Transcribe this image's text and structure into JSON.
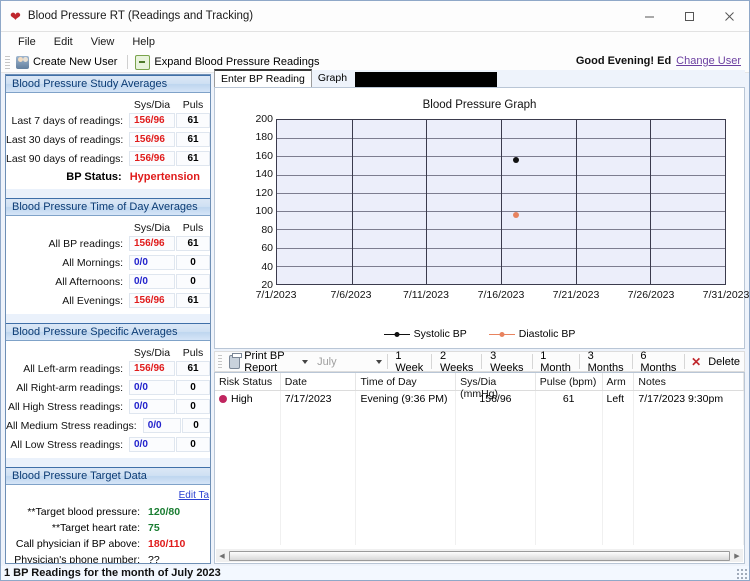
{
  "window": {
    "title": "Blood Pressure RT (Readings and Tracking)",
    "icon": "heart-icon",
    "minimize": "–",
    "maximize": "□",
    "close": "✕"
  },
  "menu": [
    "File",
    "Edit",
    "View",
    "Help"
  ],
  "toolbar": {
    "create_user": "Create New User",
    "expand_readings": "Expand Blood Pressure Readings",
    "greeting": "Good Evening! Ed",
    "change_user": "Change User"
  },
  "sidebar": {
    "study": {
      "title": "Blood Pressure Study Averages",
      "col_sysdia": "Sys/Dia",
      "col_pulse": "Puls",
      "rows": [
        {
          "label": "Last 7 days of readings:",
          "sysdia": "156/96",
          "pulse": "61",
          "tone": "red"
        },
        {
          "label": "Last 30 days of readings:",
          "sysdia": "156/96",
          "pulse": "61",
          "tone": "red"
        },
        {
          "label": "Last 90 days of readings:",
          "sysdia": "156/96",
          "pulse": "61",
          "tone": "red"
        }
      ],
      "status_label": "BP Status:",
      "status_value": "Hypertension"
    },
    "timeofday": {
      "title": "Blood Pressure Time of Day Averages",
      "col_sysdia": "Sys/Dia",
      "col_pulse": "Puls",
      "rows": [
        {
          "label": "All BP readings:",
          "sysdia": "156/96",
          "pulse": "61",
          "tone": "red"
        },
        {
          "label": "All Mornings:",
          "sysdia": "0/0",
          "pulse": "0",
          "tone": "blue"
        },
        {
          "label": "All Afternoons:",
          "sysdia": "0/0",
          "pulse": "0",
          "tone": "blue"
        },
        {
          "label": "All Evenings:",
          "sysdia": "156/96",
          "pulse": "61",
          "tone": "red"
        }
      ]
    },
    "specific": {
      "title": "Blood Pressure Specific Averages",
      "col_sysdia": "Sys/Dia",
      "col_pulse": "Puls",
      "rows": [
        {
          "label": "All Left-arm readings:",
          "sysdia": "156/96",
          "pulse": "61",
          "tone": "red"
        },
        {
          "label": "All Right-arm readings:",
          "sysdia": "0/0",
          "pulse": "0",
          "tone": "blue"
        },
        {
          "label": "All High Stress readings:",
          "sysdia": "0/0",
          "pulse": "0",
          "tone": "blue"
        },
        {
          "label": "All Medium Stress readings:",
          "sysdia": "0/0",
          "pulse": "0",
          "tone": "blue"
        },
        {
          "label": "All Low Stress readings:",
          "sysdia": "0/0",
          "pulse": "0",
          "tone": "blue"
        }
      ]
    },
    "target": {
      "title": "Blood Pressure Target Data",
      "edit_link": "Edit Ta",
      "rows": [
        {
          "label": "**Target blood pressure:",
          "value": "120/80",
          "tone": "green"
        },
        {
          "label": "**Target heart rate:",
          "value": "75",
          "tone": "green"
        },
        {
          "label": "Call physician if BP above:",
          "value": "180/110",
          "tone": "red"
        },
        {
          "label": "Physician's phone number:",
          "value": "??",
          "tone": "black"
        }
      ]
    }
  },
  "tabs": [
    {
      "label": "Enter BP Reading",
      "active": false
    },
    {
      "label": "Graph",
      "active": true
    }
  ],
  "chart_data": {
    "type": "scatter",
    "title": "Blood Pressure Graph",
    "xlabel": "",
    "ylabel": "",
    "ylim": [
      20,
      200
    ],
    "yticks": [
      200,
      180,
      160,
      140,
      120,
      100,
      80,
      60,
      40,
      20
    ],
    "xticks": [
      "7/1/2023",
      "7/6/2023",
      "7/11/2023",
      "7/16/2023",
      "7/21/2023",
      "7/26/2023",
      "7/31/2023"
    ],
    "grid": true,
    "legend_position": "bottom",
    "series": [
      {
        "name": "Systolic BP",
        "color": "#111111",
        "points": [
          {
            "x": "7/17/2023",
            "y": 156
          }
        ]
      },
      {
        "name": "Diastolic BP",
        "color": "#e8835f",
        "points": [
          {
            "x": "7/17/2023",
            "y": 96
          }
        ]
      }
    ]
  },
  "report_toolbar": {
    "print": "Print BP Report",
    "month_value": "July",
    "periods": [
      "1 Week",
      "2 Weeks",
      "3 Weeks",
      "1 Month",
      "3 Months",
      "6 Months"
    ],
    "delete": "Delete"
  },
  "grid": {
    "columns": [
      "Risk Status",
      "Date",
      "Time of Day",
      "Sys/Dia (mmHg)",
      "Pulse (bpm)",
      "Arm",
      "Notes"
    ],
    "rows": [
      {
        "risk": "High",
        "date": "7/17/2023",
        "time_of_day": "Evening (9:36 PM)",
        "sysdia": "156/96",
        "pulse": "61",
        "arm": "Left",
        "notes": "7/17/2023 9:30pm"
      }
    ]
  },
  "statusbar": {
    "text": "1 BP Readings for the month of July 2023"
  }
}
